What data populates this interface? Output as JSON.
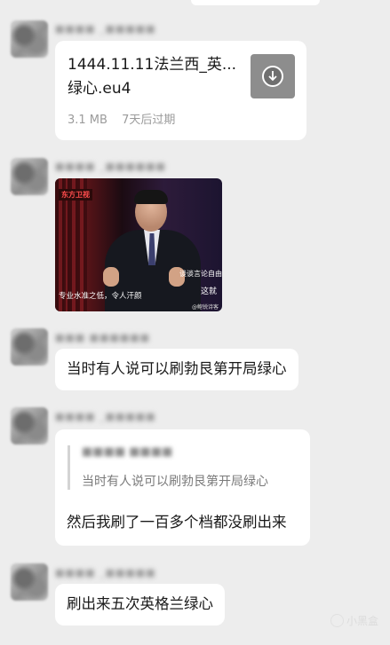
{
  "messages": {
    "file": {
      "sender": "■■■■ _■■■■■",
      "file_name_line1": "1444.11.11法兰西_英...",
      "file_name_line2": "绿心.eu4",
      "size": "3.1 MB",
      "expiry": "7天后过期",
      "icon": "download-icon"
    },
    "video": {
      "sender": "■■■■ _■■■■■■",
      "logo": "东方卫视",
      "caption_left": "专业水准之低，令人汗颜",
      "caption_right": "谈谈言论自由",
      "caption_right2": "这就",
      "watermark": "@鲍锐诗客"
    },
    "text1": {
      "sender": "■■■ ■■■■■■",
      "text": "当时有人说可以刷勃艮第开局绿心"
    },
    "quoted_reply": {
      "sender": "■■■■ _■■■■■",
      "quote_sender": "■■■■ ■■■■",
      "quote_text": "当时有人说可以刷勃艮第开局绿心",
      "text": "然后我刷了一百多个档都没刷出来"
    },
    "text2": {
      "sender": "■■■■ _■■■■■",
      "text": "刷出来五次英格兰绿心"
    }
  },
  "app_watermark": "小黑盒"
}
